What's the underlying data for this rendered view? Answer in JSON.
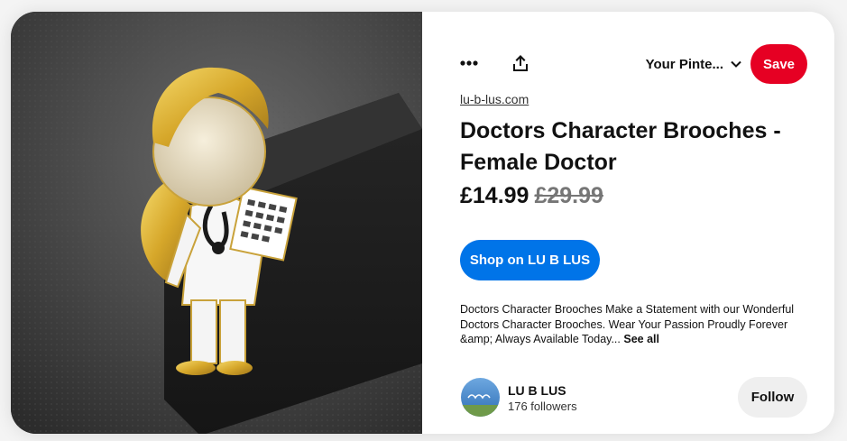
{
  "header": {
    "more_icon": "ellipsis-icon",
    "share_icon": "share-icon",
    "board_label": "Your Pinte...",
    "board_chevron_icon": "chevron-down-icon",
    "save_label": "Save",
    "save_color": "#e60023"
  },
  "pin": {
    "domain": "lu-b-lus.com",
    "title": "Doctors Character Brooches - Female Doctor",
    "price": "£14.99",
    "original_price": "£29.99",
    "shop_label": "Shop on LU B LUS",
    "shop_color": "#0074e8",
    "description": "Doctors Character Brooches Make a Statement with our Wonderful Doctors Character Brooches. Wear Your Passion Proudly Forever &amp; Always Available Today...",
    "see_all_label": "See all"
  },
  "creator": {
    "name": "LU B LUS",
    "followers": "176 followers",
    "follow_label": "Follow"
  },
  "image": {
    "description_icon": "product-photo"
  }
}
